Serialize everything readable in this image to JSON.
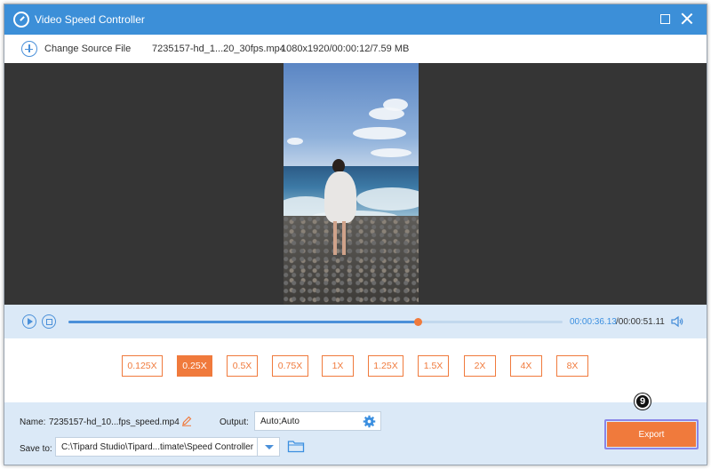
{
  "window": {
    "title": "Video Speed Controller"
  },
  "file_bar": {
    "change_source_label": "Change Source File",
    "file_name": "7235157-hd_1...20_30fps.mp4",
    "file_meta": "1080x1920/00:00:12/7.59 MB"
  },
  "player": {
    "current_time": "00:00:36.13",
    "total_time": "/00:00:51.11",
    "progress_fraction": 0.707
  },
  "speeds": {
    "options": [
      "0.125X",
      "0.25X",
      "0.5X",
      "0.75X",
      "1X",
      "1.25X",
      "1.5X",
      "2X",
      "4X",
      "8X"
    ],
    "selected": "0.25X"
  },
  "output_panel": {
    "name_label": "Name:",
    "name_value": "7235157-hd_10...fps_speed.mp4",
    "output_label": "Output:",
    "output_value": "Auto;Auto",
    "save_label": "Save to:",
    "save_path": "C:\\Tipard Studio\\Tipard...timate\\Speed Controller",
    "export_label": "Export",
    "step_badge": "9"
  },
  "colors": {
    "accent": "#f07a3c",
    "titlebar": "#3c8fd8",
    "link": "#3b8fe0"
  },
  "icons": [
    "app-logo-icon",
    "maximize-icon",
    "close-icon",
    "add-icon",
    "play-icon",
    "stop-icon",
    "volume-icon",
    "edit-icon",
    "gear-icon",
    "chevron-down-icon",
    "folder-icon"
  ]
}
